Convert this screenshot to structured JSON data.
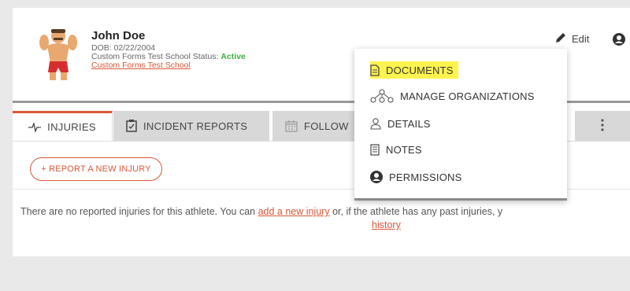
{
  "athlete": {
    "name": "John Doe",
    "dob": "DOB: 02/22/2004",
    "status_prefix": "Custom Forms Test School Status: ",
    "status_value": "Active",
    "school_link": "Custom Forms Test School"
  },
  "header": {
    "edit_label": "Edit"
  },
  "tabs": [
    {
      "label": "INJURIES",
      "icon": "pulse-icon",
      "active": true
    },
    {
      "label": "INCIDENT REPORTS",
      "icon": "clipboard-icon",
      "active": false
    },
    {
      "label": "FOLLOW",
      "icon": "calendar-icon",
      "active": false
    }
  ],
  "actions": {
    "report_label": "+ REPORT A NEW INJURY"
  },
  "empty_state": {
    "text_before": "There are no reported injuries for this athlete. You can ",
    "link_add": "add a new injury",
    "text_after": " or, if the athlete has any past injuries, y",
    "link_history": "history"
  },
  "menu": {
    "items": [
      {
        "label": "DOCUMENTS",
        "icon": "document-icon",
        "highlighted": true
      },
      {
        "label": "MANAGE ORGANIZATIONS",
        "icon": "organization-icon"
      },
      {
        "label": "DETAILS",
        "icon": "user-icon"
      },
      {
        "label": "NOTES",
        "icon": "notes-icon"
      },
      {
        "label": "PERMISSIONS",
        "icon": "user-circle-icon"
      }
    ]
  },
  "colors": {
    "accent": "#d9583a",
    "active_status": "#3fae3f",
    "highlight": "#fff44f"
  }
}
